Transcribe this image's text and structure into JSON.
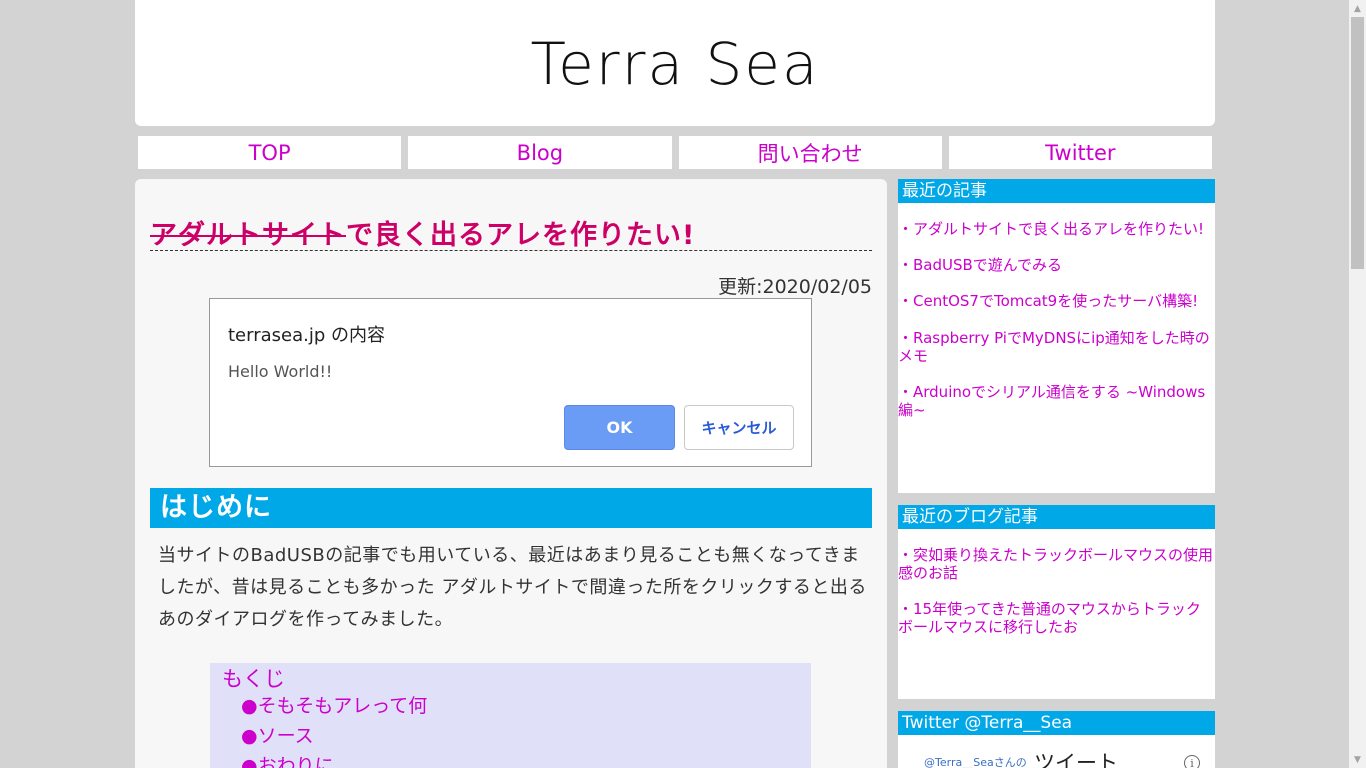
{
  "site": {
    "title": "Terra Sea"
  },
  "nav": {
    "items": [
      "TOP",
      "Blog",
      "問い合わせ",
      "Twitter"
    ]
  },
  "article": {
    "title_struck": "アダルトサイト",
    "title_rest": "で良く出るアレを作りたい!",
    "updated": "更新:2020/02/05",
    "dialog": {
      "title": "terrasea.jp の内容",
      "message": "Hello World!!",
      "ok_label": "OK",
      "cancel_label": "キャンセル"
    },
    "section_heading": "はじめに",
    "intro_text": "当サイトのBadUSBの記事でも用いている、最近はあまり見ることも無くなってきましたが、昔は見ることも多かった アダルトサイトで間違った所をクリックすると出るあのダイアログを作ってみました。",
    "toc": {
      "title": "もくじ",
      "items": [
        "●そもそもアレって何",
        "●ソース",
        "●おわりに"
      ]
    }
  },
  "sidebar": {
    "recent_articles": {
      "heading": "最近の記事",
      "items": [
        "・アダルトサイトで良く出るアレを作りたい!",
        "・BadUSBで遊んでみる",
        "・CentOS7でTomcat9を使ったサーバ構築!",
        "・Raspberry PiでMyDNSにip通知をした時のメモ",
        "・Arduinoでシリアル通信をする ~Windows編~"
      ]
    },
    "recent_blog": {
      "heading": "最近のブログ記事",
      "items": [
        "・突如乗り換えたトラックボールマウスの使用感のお話",
        "・15年使ってきた普通のマウスからトラックボールマウスに移行したお"
      ]
    },
    "twitter": {
      "heading": "Twitter @Terra__Sea",
      "embed_label": "@Terra__Seaさんの",
      "embed_title": "ツイート"
    }
  },
  "colors": {
    "accent": "#00a8e8",
    "link": "#cc00cc",
    "title": "#cc0066",
    "background": "#d3d3d3"
  }
}
